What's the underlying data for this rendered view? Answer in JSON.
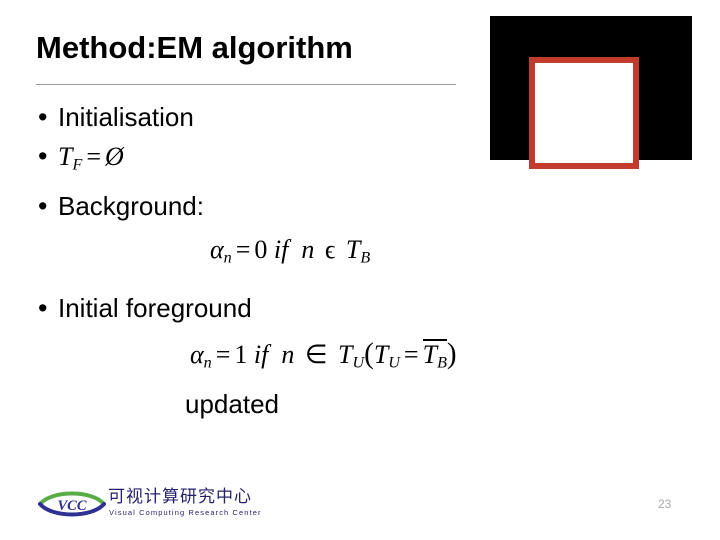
{
  "slide": {
    "title": "Method:EM algorithm",
    "page_number": "23"
  },
  "content": {
    "bullet_marker": "•",
    "items": [
      {
        "type": "text",
        "label": "Initialisation"
      },
      {
        "type": "math",
        "label": "T_F = Ø"
      },
      {
        "type": "text",
        "label": "Background:"
      },
      {
        "type": "text",
        "label": "Initial foreground"
      }
    ],
    "equations": [
      {
        "id": "eq-background",
        "label": "αn= 0 if n ϵ TB"
      },
      {
        "id": "eq-foreground",
        "label": "αn = 1 if n ∈ TU(TU = TB̅)"
      }
    ],
    "math_tokens": {
      "T": "T",
      "sub_F": "F",
      "equals": "=",
      "emptyset": "Ø",
      "alpha": "α",
      "sub_n": "n",
      "zero": "0",
      "one": "1",
      "if": "if",
      "n": "n",
      "epsilon_member": "ϵ",
      "element_of": "∈",
      "sub_B": "B",
      "sub_U": "U",
      "paren_open": "(",
      "paren_close": ")"
    },
    "updated_label": "updated"
  },
  "figure": {
    "name": "black-image-with-red-box",
    "background_color": "#000000",
    "box_fill_color": "#ffffff",
    "box_border_color": "#C33B2C"
  },
  "logo": {
    "mark_text": "VCC",
    "chinese_name": "可视计算研究中心",
    "english_name": "Visual Computing Research Center",
    "green_color": "#5aad46",
    "blue_color": "#2e3192"
  }
}
